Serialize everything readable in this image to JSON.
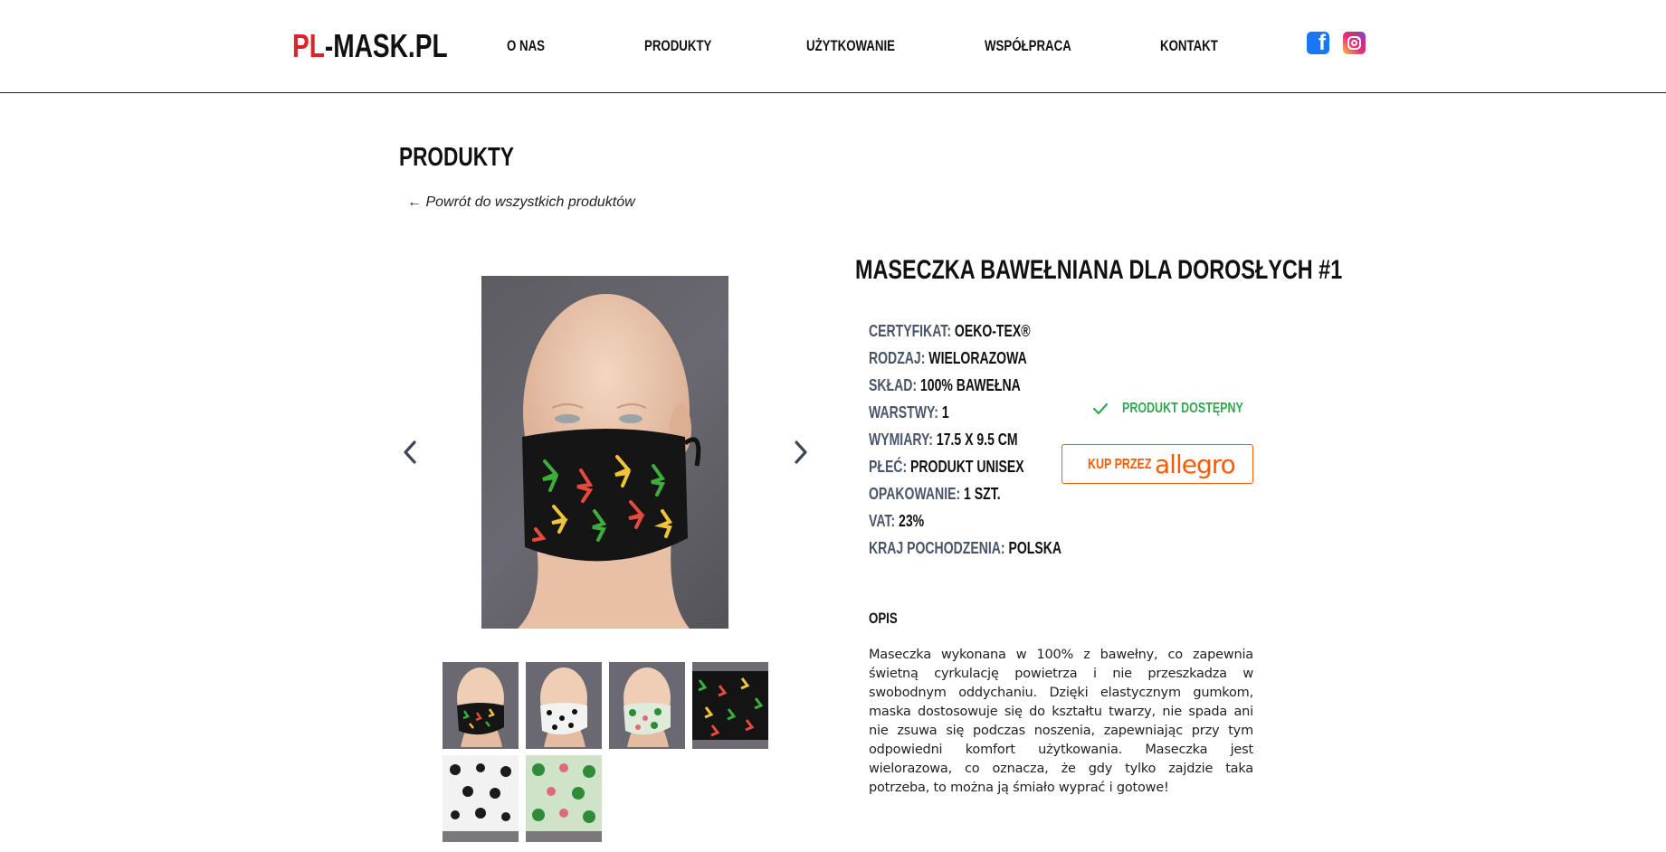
{
  "header": {
    "logo_part1": "PL",
    "logo_part2": "-MASK.PL",
    "nav": [
      "O NAS",
      "PRODUKTY",
      "UŻYTKOWANIE",
      "WSPÓŁPRACA",
      "KONTAKT"
    ],
    "facebook_icon": "facebook-icon",
    "instagram_icon": "instagram-icon"
  },
  "page": {
    "title": "PRODUKTY",
    "back_link": "← Powrót do wszystkich produktów"
  },
  "product": {
    "title": "MASECZKA BAWEŁNIANA DLA DOROSŁYCH #1",
    "specs": [
      {
        "label": "CERTYFIKAT:",
        "value": "OEKO-TEX®"
      },
      {
        "label": "RODZAJ:",
        "value": "WIELORAZOWA"
      },
      {
        "label": "SKŁAD:",
        "value": "100% BAWEŁNA"
      },
      {
        "label": "WARSTWY:",
        "value": "1"
      },
      {
        "label": "WYMIARY:",
        "value": "17.5 X 9.5 CM"
      },
      {
        "label": "PŁEĆ:",
        "value": "PRODUKT UNISEX"
      },
      {
        "label": "OPAKOWANIE:",
        "value": "1 SZT."
      },
      {
        "label": "VAT:",
        "value": "23%"
      },
      {
        "label": "KRAJ POCHODZENIA:",
        "value": "POLSKA"
      }
    ],
    "availability": "PRODUKT DOSTĘPNY",
    "buy_prefix": "KUP PRZEZ",
    "buy_brand": "allegro",
    "description_heading": "OPIS",
    "description": "Maseczka wykonana w 100% z bawełny, co zapewnia świetną cyrkulację powietrza i nie przeszkadza w swobodnym oddychaniu. Dzięki elastycznym gumkom, maska dostosowuje się do kształtu twarzy, nie spada ani nie zsuwa się podczas noszenia, zapewniając przy tym odpowiedni komfort użytkowania. Maseczka jest wielorazowa, co oznacza, że gdy tylko zajdzie taka potrzeba, to można ją śmiało wyprać i gotowe!"
  },
  "colors": {
    "brand_red": "#d9232d",
    "allegro_orange": "#ff5a00",
    "available_green": "#2fa84f",
    "label_gray": "#4a5568"
  }
}
